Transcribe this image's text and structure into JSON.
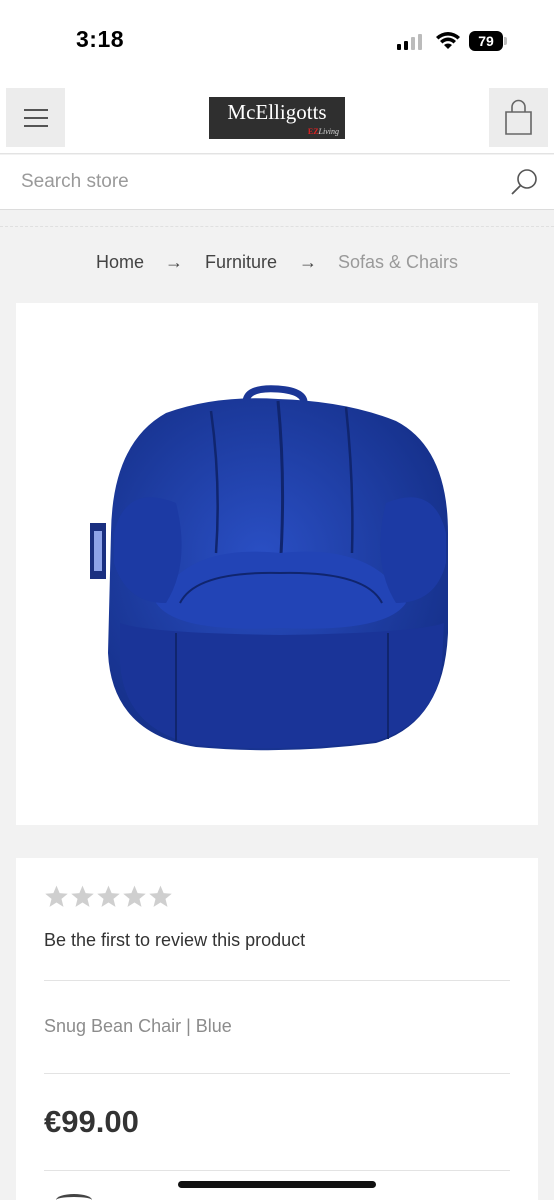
{
  "status_bar": {
    "time": "3:18",
    "battery": "79"
  },
  "header": {
    "menu_icon": "hamburger-menu-icon",
    "logo": {
      "name": "McElligotts",
      "sub_brand": "EZ",
      "sub_script": "Living"
    },
    "cart_icon": "shopping-bag-icon"
  },
  "search": {
    "placeholder": "Search store",
    "icon": "search-icon"
  },
  "breadcrumb": {
    "items": [
      "Home",
      "Furniture",
      "Sofas & Chairs"
    ],
    "separator": "→"
  },
  "product": {
    "image_alt": "Snug Bean Chair | Blue",
    "image_color": "#1f3fa8",
    "rating": 0,
    "rating_max": 5,
    "review_text": "Be the first to review this product",
    "name": "Snug Bean Chair | Blue",
    "price": "€99.00"
  }
}
